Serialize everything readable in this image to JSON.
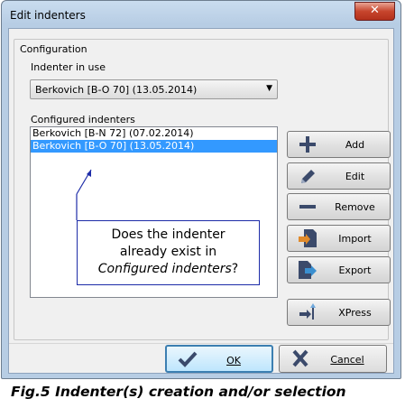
{
  "window": {
    "title": "Edit indenters",
    "close_label": "✕"
  },
  "group": {
    "label": "Configuration"
  },
  "indenter_in_use": {
    "label": "Indenter in use",
    "value": "Berkovich [B-O 70] (13.05.2014)"
  },
  "configured": {
    "label": "Configured indenters",
    "items": [
      {
        "label": "Berkovich [B-N 72] (07.02.2014)",
        "selected": false
      },
      {
        "label": "Berkovich [B-O 70] (13.05.2014)",
        "selected": true
      }
    ]
  },
  "buttons": {
    "add": "Add",
    "edit": "Edit",
    "remove": "Remove",
    "import": "Import",
    "export": "Export",
    "xpress": "XPress"
  },
  "callout": {
    "line1": "Does the indenter",
    "line2": "already exist in",
    "line3_italic": "Configured indenters",
    "line3_tail": "?"
  },
  "footer": {
    "ok": "OK",
    "cancel": "Cancel"
  },
  "caption": "Fig.5 Indenter(s) creation and/or selection",
  "colors": {
    "selection": "#3399ff",
    "callout_border": "#1d2ca8",
    "ok_border": "#3c7fb1"
  }
}
